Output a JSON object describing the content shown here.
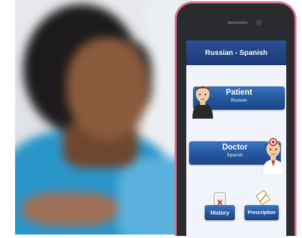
{
  "app": {
    "title": "Russian - Spanish",
    "patient": {
      "label": "Patient",
      "language": "Russian"
    },
    "doctor": {
      "label": "Doctor",
      "language": "Spanish"
    },
    "history_label": "History",
    "prescription_label": "Prescription"
  },
  "colors": {
    "appbar": "#1f437f",
    "button": "#2b5ea8",
    "phone_frame": "#e16f8c",
    "scrubs": "#2a95c9"
  },
  "icons": [
    "patient-avatar-icon",
    "doctor-avatar-icon",
    "history-icon",
    "prescription-icon"
  ]
}
